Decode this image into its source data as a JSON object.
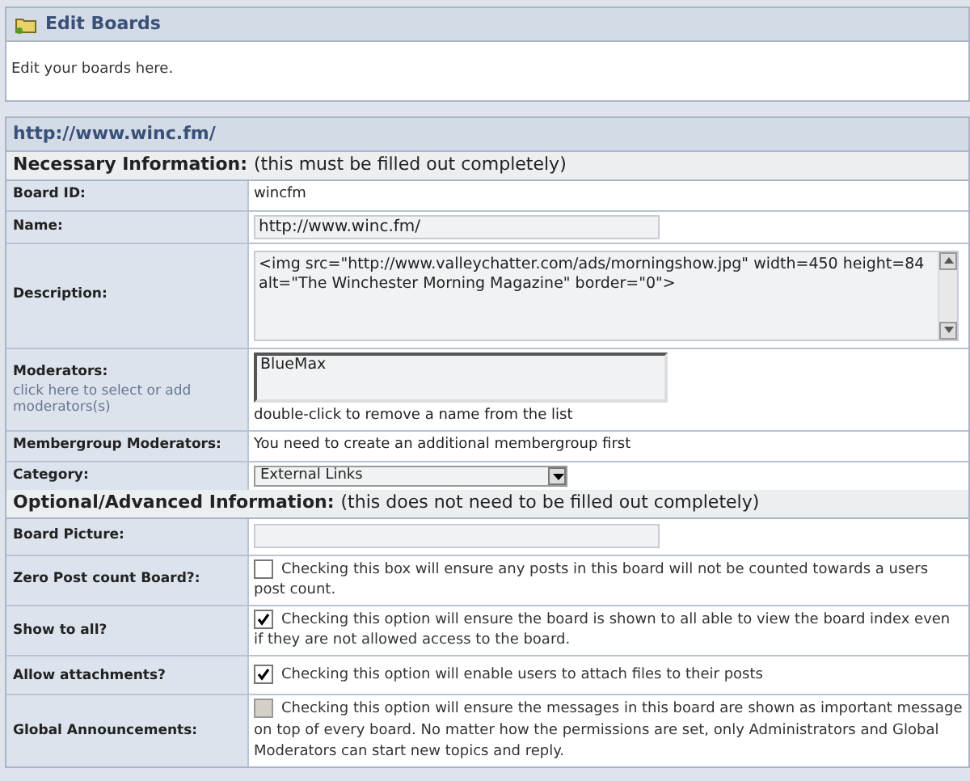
{
  "header": {
    "title": "Edit Boards",
    "description": "Edit your boards here."
  },
  "board": {
    "title": "http://www.winc.fm/",
    "sections": [
      {
        "heading": "Necessary Information:",
        "note": "(this must be filled out completely)",
        "rows": [
          {
            "kind": "text",
            "label": "Board ID:",
            "value": "wincfm"
          },
          {
            "kind": "input",
            "label": "Name:",
            "value": "http://www.winc.fm/"
          },
          {
            "kind": "textarea",
            "label": "Description:",
            "value": "<img src=\"http://www.valleychatter.com/ads/morningshow.jpg\" width=450 height=84 alt=\"The Winchester Morning Magazine\" border=\"0\">"
          },
          {
            "kind": "moderators",
            "label": "Moderators:",
            "link": "click here to select or add moderators(s)",
            "items": [
              "BlueMax"
            ],
            "hint": "double-click to remove a name from the list"
          },
          {
            "kind": "text",
            "label": "Membergroup Moderators:",
            "value": "You need to create an additional membergroup first"
          },
          {
            "kind": "select",
            "label": "Category:",
            "value": "External Links"
          }
        ]
      },
      {
        "heading": "Optional/Advanced Information:",
        "note": "(this does not need to be filled out completely)",
        "rows": [
          {
            "kind": "input",
            "label": "Board Picture:"
          },
          {
            "kind": "checkbox",
            "label": "Zero Post count Board?:",
            "checked": false,
            "disabled": false,
            "text": "Checking this box will ensure any posts in this board will not be counted towards a users post count."
          },
          {
            "kind": "checkbox",
            "label": "Show to all?",
            "checked": true,
            "disabled": false,
            "text": "Checking this option will ensure the board is shown to all able to view the board index even if they are not allowed access to the board."
          },
          {
            "kind": "checkbox",
            "label": "Allow attachments?",
            "checked": true,
            "disabled": false,
            "text": "Checking this option will enable users to attach files to their posts"
          },
          {
            "kind": "checkbox",
            "label": "Global Announcements:",
            "checked": false,
            "disabled": true,
            "text": "Checking this option will ensure the messages in this board are shown as important message on top of every board. No matter how the permissions are set, only Administrators and Global Moderators can start new topics and reply."
          }
        ]
      }
    ]
  }
}
